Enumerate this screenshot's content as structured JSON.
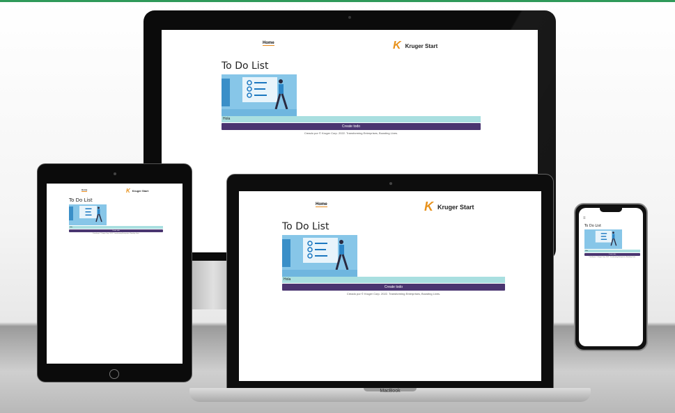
{
  "app": {
    "nav_home": "Home",
    "brand_letter": "K",
    "brand_name": "Kruger Start",
    "title": "To Do List",
    "input_value": "Hola",
    "create_button": "Create todo",
    "footer": "Creado por © Kruger Corp. 2022. Transforming Enterprises, Boosting Lives."
  },
  "devices": {
    "laptop_label": "MacBook"
  }
}
